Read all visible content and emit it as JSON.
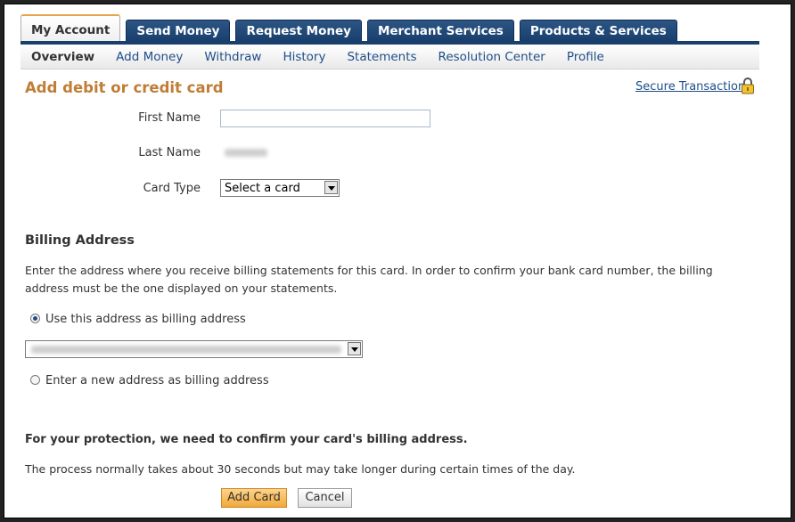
{
  "tabs": [
    "My Account",
    "Send Money",
    "Request Money",
    "Merchant Services",
    "Products & Services"
  ],
  "subnav": [
    "Overview",
    "Add Money",
    "Withdraw",
    "History",
    "Statements",
    "Resolution Center",
    "Profile"
  ],
  "page": {
    "title": "Add debit or credit card",
    "secure_link": "Secure Transaction"
  },
  "form": {
    "first_name_label": "First Name",
    "first_name_value": "",
    "last_name_label": "Last Name",
    "card_type_label": "Card Type",
    "card_type_value": "Select a card"
  },
  "billing": {
    "heading": "Billing Address",
    "description": "Enter the address where you receive billing statements for this card. In order to confirm your bank card number, the billing address must be the one displayed on your statements.",
    "use_existing_label": "Use this address as billing address",
    "enter_new_label": "Enter a new address as billing address"
  },
  "protection": {
    "heading": "For your protection, we need to confirm your card's billing address.",
    "note": "The process normally takes about 30 seconds but may take longer during certain times of the day."
  },
  "buttons": {
    "add_card": "Add Card",
    "cancel": "Cancel"
  },
  "colors": {
    "title": "#c07d36",
    "nav": "#1a3f6d",
    "link": "#1f4e88"
  }
}
